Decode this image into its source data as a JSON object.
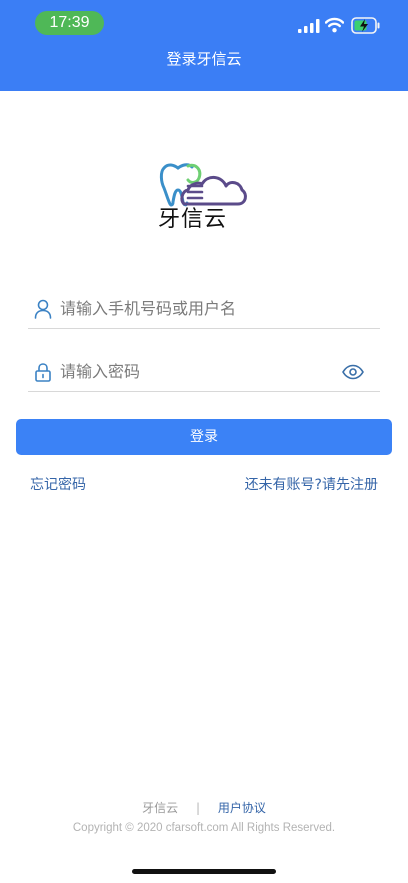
{
  "status_bar": {
    "time": "17:39",
    "icons": [
      "signal-icon",
      "wifi-icon",
      "battery-charging-icon"
    ]
  },
  "header": {
    "title": "登录牙信云"
  },
  "logo": {
    "text": "牙信云",
    "colors": {
      "tooth": "#3a8fc9",
      "accent": "#6fcf73",
      "cloud": "#5b4b8a"
    }
  },
  "form": {
    "username": {
      "value": "",
      "placeholder": "请输入手机号码或用户名",
      "icon": "user-icon"
    },
    "password": {
      "value": "",
      "placeholder": "请输入密码",
      "icon": "lock-icon",
      "toggle_icon": "eye-icon"
    },
    "login_label": "登录"
  },
  "links": {
    "forgot": "忘记密码",
    "register": "还未有账号?请先注册"
  },
  "footer": {
    "app_name": "牙信云",
    "separator": "|",
    "agreement": "用户协议",
    "copyright": "Copyright © 2020 cfarsoft.com All Rights Reserved."
  },
  "colors": {
    "header": "#3b7ef5",
    "button": "#3b82f6",
    "link": "#3565a8",
    "time_pill": "#4fb857"
  }
}
